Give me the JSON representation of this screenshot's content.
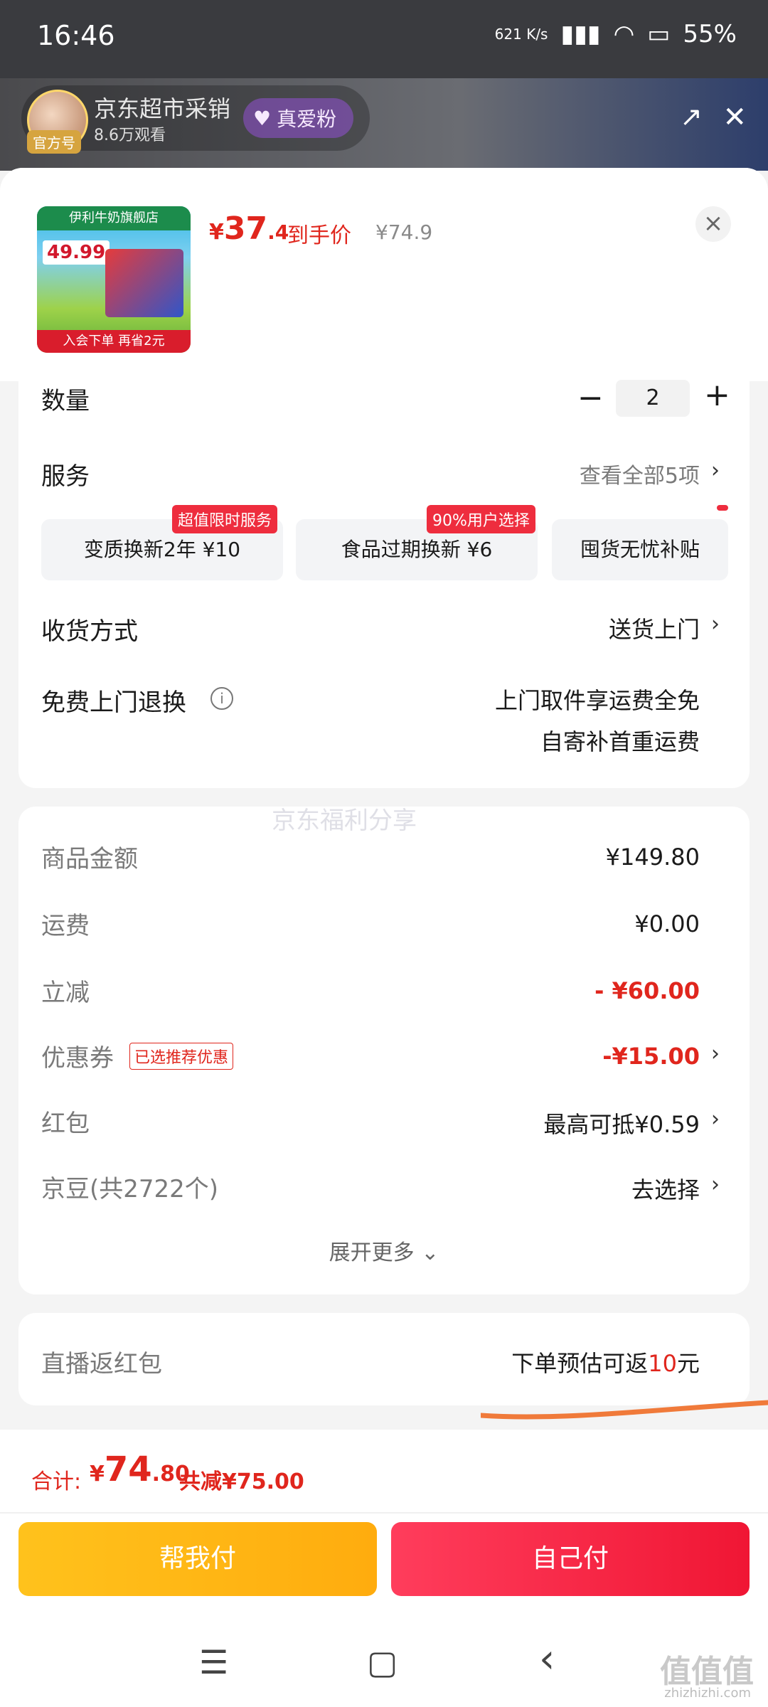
{
  "status_bar": {
    "time": "16:46",
    "network": "621 K/s",
    "battery": "55%"
  },
  "live": {
    "store_name": "京东超市采销",
    "viewers": "8.6万观看",
    "official_tag": "官方号",
    "fan_badge": "真爱粉"
  },
  "product": {
    "thumb_banner": "伊利牛奶旗舰店",
    "thumb_price": "49.99",
    "thumb_footer": "入会下单 再省2元",
    "deal_price_yen": "¥",
    "deal_price_int": "37",
    "deal_price_dec": ".4",
    "deal_price_label": "到手价",
    "original_price": "¥74.9",
    "close_icon": "×"
  },
  "quantity": {
    "label": "数量",
    "minus": "−",
    "value": "2",
    "plus": "+"
  },
  "service": {
    "label": "服务",
    "view_all": "查看全部5项",
    "items": [
      {
        "tag": "超值限时服务",
        "name": "变质换新2年  ¥10"
      },
      {
        "tag": "90%用户选择",
        "name": "食品过期换新  ¥6"
      },
      {
        "tag": "",
        "name": "囤货无忧补贴"
      }
    ]
  },
  "delivery": {
    "label": "收货方式",
    "value": "送货上门"
  },
  "returns": {
    "label": "免费上门退换",
    "line1": "上门取件享运费全免",
    "line2": "自寄补首重运费"
  },
  "watermark": "京东福利分享",
  "summary": {
    "goods_label": "商品金额",
    "goods_value": "¥149.80",
    "shipping_label": "运费",
    "shipping_value": "¥0.00",
    "instant_label": "立减",
    "instant_value": "- ¥60.00",
    "coupon_label": "优惠券",
    "coupon_tag": "已选推荐优惠",
    "coupon_value": "-¥15.00",
    "redpacket_label": "红包",
    "redpacket_value": "最高可抵¥0.59",
    "jingdou_label": "京豆(共2722个)",
    "jingdou_value": "去选择",
    "expand": "展开更多 ⌄"
  },
  "live_rebate": {
    "label": "直播返红包",
    "value_prefix": "下单预估可返",
    "value_amount": "10",
    "value_suffix": "元"
  },
  "footer": {
    "total_label": "合计:",
    "total_yen": "¥",
    "total_int": "74",
    "total_dec": ".80",
    "discount": "共减¥75.00",
    "help_pay": "帮我付",
    "self_pay": "自己付"
  },
  "navbar": {
    "menu": "☰",
    "home": "▢",
    "back": "‹"
  },
  "site_mark": "值值值",
  "site_url": "zhizhizhi.com",
  "colors": {
    "price_red": "#e0261d",
    "help_pay": "#ffb316",
    "self_pay": "#f5203f"
  }
}
